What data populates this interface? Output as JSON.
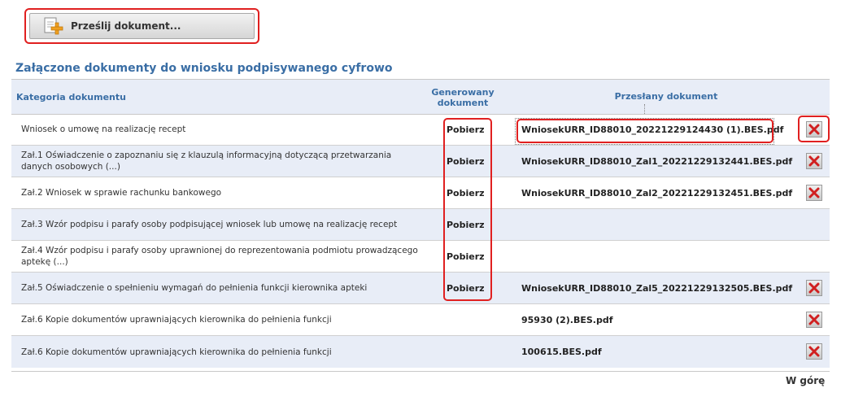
{
  "upload_button": {
    "label": "Prześlij dokument...",
    "icon": "add-document-icon"
  },
  "section_title": "Załączone dokumenty do wniosku podpisywanego cyfrowo",
  "table": {
    "headers": {
      "category": "Kategoria dokumentu",
      "generated": "Generowany dokument",
      "uploaded": "Przesłany dokument"
    },
    "rows": [
      {
        "category": "Wniosek o umowę na realizację recept",
        "generated": "Pobierz",
        "uploaded": "WniosekURR_ID88010_20221229124430 (1).BES.pdf",
        "has_delete": true
      },
      {
        "category": "Zał.1 Oświadczenie o zapoznaniu się z klauzulą informacyjną dotyczącą przetwarzania danych osobowych (...)",
        "generated": "Pobierz",
        "uploaded": "WniosekURR_ID88010_Zal1_20221229132441.BES.pdf",
        "has_delete": true
      },
      {
        "category": "Zał.2 Wniosek w sprawie rachunku bankowego",
        "generated": "Pobierz",
        "uploaded": "WniosekURR_ID88010_Zal2_20221229132451.BES.pdf",
        "has_delete": true
      },
      {
        "category": "Zał.3 Wzór podpisu i parafy osoby podpisującej wniosek lub umowę na realizację recept",
        "generated": "Pobierz",
        "uploaded": "",
        "has_delete": false
      },
      {
        "category": "Zał.4 Wzór podpisu i parafy osoby uprawnionej do reprezentowania podmiotu prowadzącego aptekę (...)",
        "generated": "Pobierz",
        "uploaded": "",
        "has_delete": false
      },
      {
        "category": "Zał.5 Oświadczenie o spełnieniu wymagań do pełnienia funkcji kierownika apteki",
        "generated": "Pobierz",
        "uploaded": "WniosekURR_ID88010_Zal5_20221229132505.BES.pdf",
        "has_delete": true
      },
      {
        "category": "Zał.6 Kopie dokumentów uprawniających kierownika do pełnienia funkcji",
        "generated": "",
        "uploaded": "95930 (2).BES.pdf",
        "has_delete": true
      },
      {
        "category": "Zał.6 Kopie dokumentów uprawniających kierownika do pełnienia funkcji",
        "generated": "",
        "uploaded": "100615.BES.pdf",
        "has_delete": true
      }
    ]
  },
  "delete_icon": "delete-x-icon",
  "back_to_top": "W górę",
  "colors": {
    "accent": "#3a6ea5",
    "highlight": "#e02020",
    "row_alt": "#e8edf7"
  }
}
